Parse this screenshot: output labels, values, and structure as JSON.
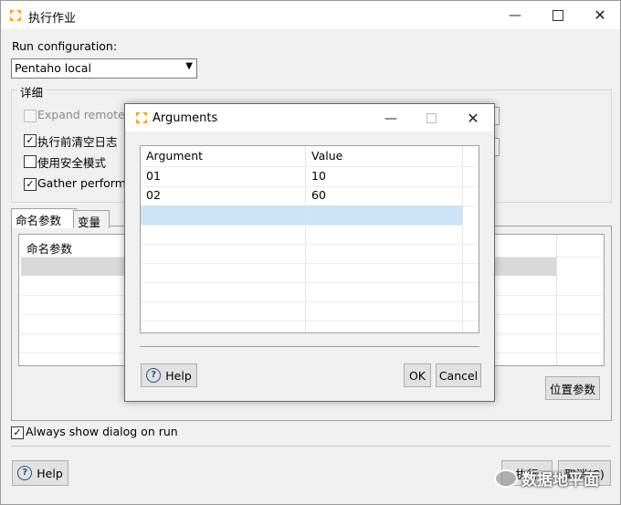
{
  "window": {
    "title": "执行作业",
    "minimize_icon": "minimize-icon",
    "maximize_icon": "maximize-icon",
    "close_icon": "close-icon"
  },
  "run_config": {
    "label": "Run configuration:",
    "value": "Pentaho local"
  },
  "details": {
    "legend": "详细",
    "options": [
      {
        "label": "Expand remote jo",
        "checked": false,
        "enabled": false
      },
      {
        "label": "执行前清空日志",
        "checked": true,
        "enabled": true
      },
      {
        "label": "使用安全模式",
        "checked": false,
        "enabled": true
      },
      {
        "label": "Gather performa",
        "checked": true,
        "enabled": true
      }
    ]
  },
  "tabs": [
    {
      "label": "命名参数",
      "active": true
    },
    {
      "label": "变量",
      "active": false
    }
  ],
  "params_table": {
    "header": "命名参数"
  },
  "position_params_button": "位置参数",
  "always_show": {
    "label": "Always show dialog on run",
    "checked": true
  },
  "footer": {
    "help_label": "Help",
    "run_label": "执行",
    "cancel_label": "取消(C)"
  },
  "watermark": "数据地平面",
  "dialog": {
    "title": "Arguments",
    "columns": [
      "Argument",
      "Value"
    ],
    "rows": [
      {
        "argument": "01",
        "value": "10"
      },
      {
        "argument": "02",
        "value": "60"
      },
      {
        "argument": "",
        "value": ""
      }
    ],
    "help_label": "Help",
    "ok_label": "OK",
    "cancel_label": "Cancel"
  },
  "colors": {
    "selection": "#cce4f7",
    "accent": "#f5a623"
  }
}
